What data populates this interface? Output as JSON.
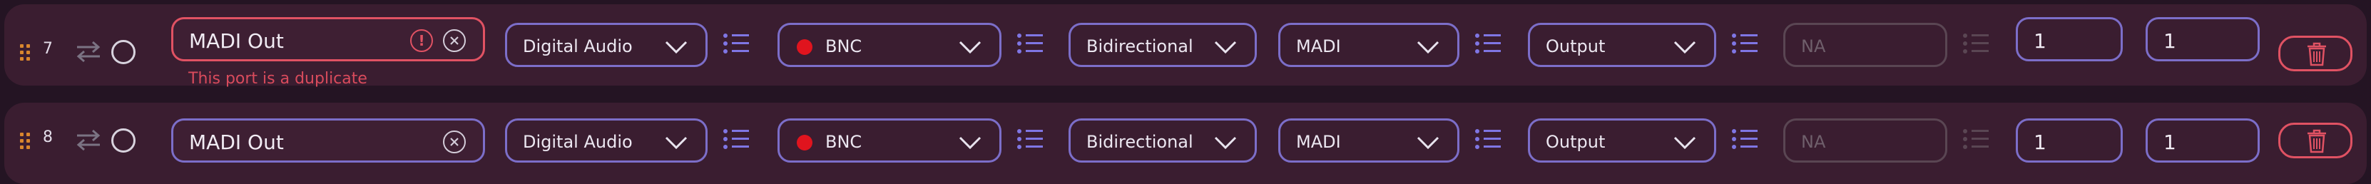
{
  "colors": {
    "background": "#241423",
    "row": "#3a1d30",
    "accent": "#7c6ec9",
    "error": "#e05263",
    "drag_handle": "#d9862d",
    "connector_dot": "#e0141e"
  },
  "rows": [
    {
      "index": "7",
      "name_value": "MADI Out",
      "error_text": "This port is a duplicate",
      "signal_type": "Digital Audio",
      "connector": "BNC",
      "direction": "Bidirectional",
      "format": "MADI",
      "io_mode": "Output",
      "na_select": "NA",
      "channel_start": "1",
      "channel_count": "1"
    },
    {
      "index": "8",
      "name_value": "MADI Out",
      "signal_type": "Digital Audio",
      "connector": "BNC",
      "direction": "Bidirectional",
      "format": "MADI",
      "io_mode": "Output",
      "na_select": "NA",
      "channel_start": "1",
      "channel_count": "1"
    }
  ],
  "icons": {
    "drag": "drag-handle-icon",
    "swap": "swap-arrows-icon",
    "clear": "close-circle-icon",
    "alert": "exclamation-circle-icon",
    "chevron": "chevron-down-icon",
    "list": "list-options-icon",
    "trash": "trash-icon"
  }
}
